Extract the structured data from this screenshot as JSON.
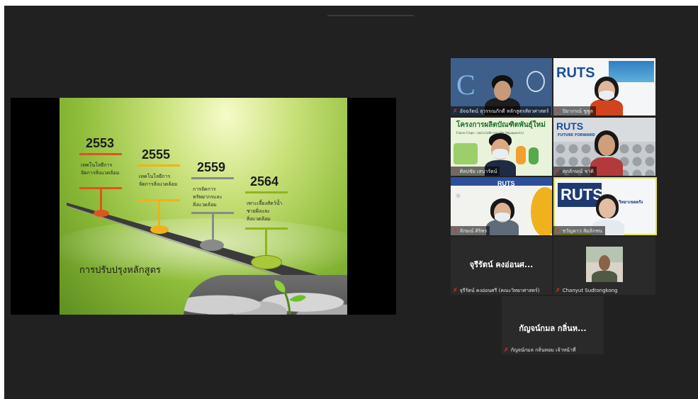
{
  "slide": {
    "milestones": [
      {
        "year": "2553",
        "line1": "เทคโนโลยีการ",
        "line2": "จัดการสิ่งแวดล้อม",
        "line3": "",
        "color": "#e0531f"
      },
      {
        "year": "2555",
        "line1": "เทคโนโลยีการ",
        "line2": "จัดการสิ่งแวดล้อม",
        "line3": "",
        "color": "#f0b21c"
      },
      {
        "year": "2559",
        "line1": "การจัดการ",
        "line2": "ทรัพยากรและ",
        "line3": "สิ่งแวดล้อม",
        "color": "#8a8a8a"
      },
      {
        "year": "2564",
        "line1": "เพาะเลี้ยงสัตว์น้ำ",
        "line2": "ชายฝั่งและ",
        "line3": "สิ่งแวดล้อม",
        "color": "#8db51f"
      }
    ],
    "title": "การปรับปรุงหลักสูตร"
  },
  "participants": [
    {
      "name": "อัจฉรัตน์ สุวรรณภักดี หลักสูตรสัตวศาสตร์",
      "muted": true
    },
    {
      "name": "ปิยาภรณ์ ชูพูล",
      "muted": true
    },
    {
      "name": "ศิลปชัย เสนารัตน์",
      "muted": true,
      "banner": "โครงการผลิตบัณฑิตพันธุ์ใหม่",
      "banner_sub": "Future Crops : เทคโนโลยีการปลูกพืช (Aquaponics)"
    },
    {
      "name": "ศุภลักษณ์ ชาติ",
      "muted": true,
      "logo": "RUTS",
      "logo_sub": "FUTURE FORWARD"
    },
    {
      "name": "ลักษณ์ ศิริพร",
      "muted": true,
      "logo": "RUTS"
    },
    {
      "name": "ขวัญดาว สิมลิกชน",
      "muted": true,
      "logo": "RUTS",
      "logo_sub": "วิทยาเขตตรัง"
    },
    {
      "name": "จุรีรัตน์ คงอ่อนศรี (คณะวิทยาศาสตร์)",
      "display": "จุรีรัตน์ คงอ่อนศ...",
      "muted": true
    },
    {
      "name": "Chanyut Sudtongkong",
      "muted": true
    },
    {
      "name": "กัญจน์กมล กลิ่นหอม เจ้าหน้าที่",
      "display": "กัญจน์กมล กลิ่นห...",
      "muted": true
    }
  ],
  "icons": {
    "muted_mic": "mic-off-icon"
  }
}
